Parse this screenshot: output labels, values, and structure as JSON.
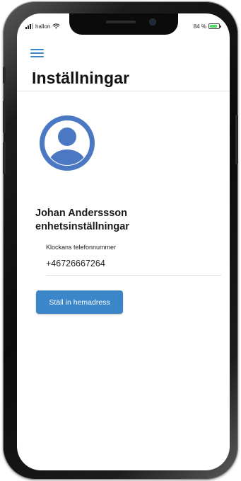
{
  "status_bar": {
    "carrier": "hallon",
    "battery_percent": "84 %",
    "battery_level": 0.84
  },
  "header": {
    "title": "Inställningar",
    "menu_icon": "hamburger-menu-icon"
  },
  "profile": {
    "avatar_icon": "user-circle-icon",
    "name": "Johan Anderssson",
    "subtitle": "enhetsinställningar"
  },
  "phone_field": {
    "label": "Klockans telefonnummer",
    "value": "+46726667264"
  },
  "actions": {
    "set_home_address_label": "Ställ in hemadress"
  },
  "colors": {
    "accent": "#3a86c8",
    "avatar": "#4a78c2"
  }
}
